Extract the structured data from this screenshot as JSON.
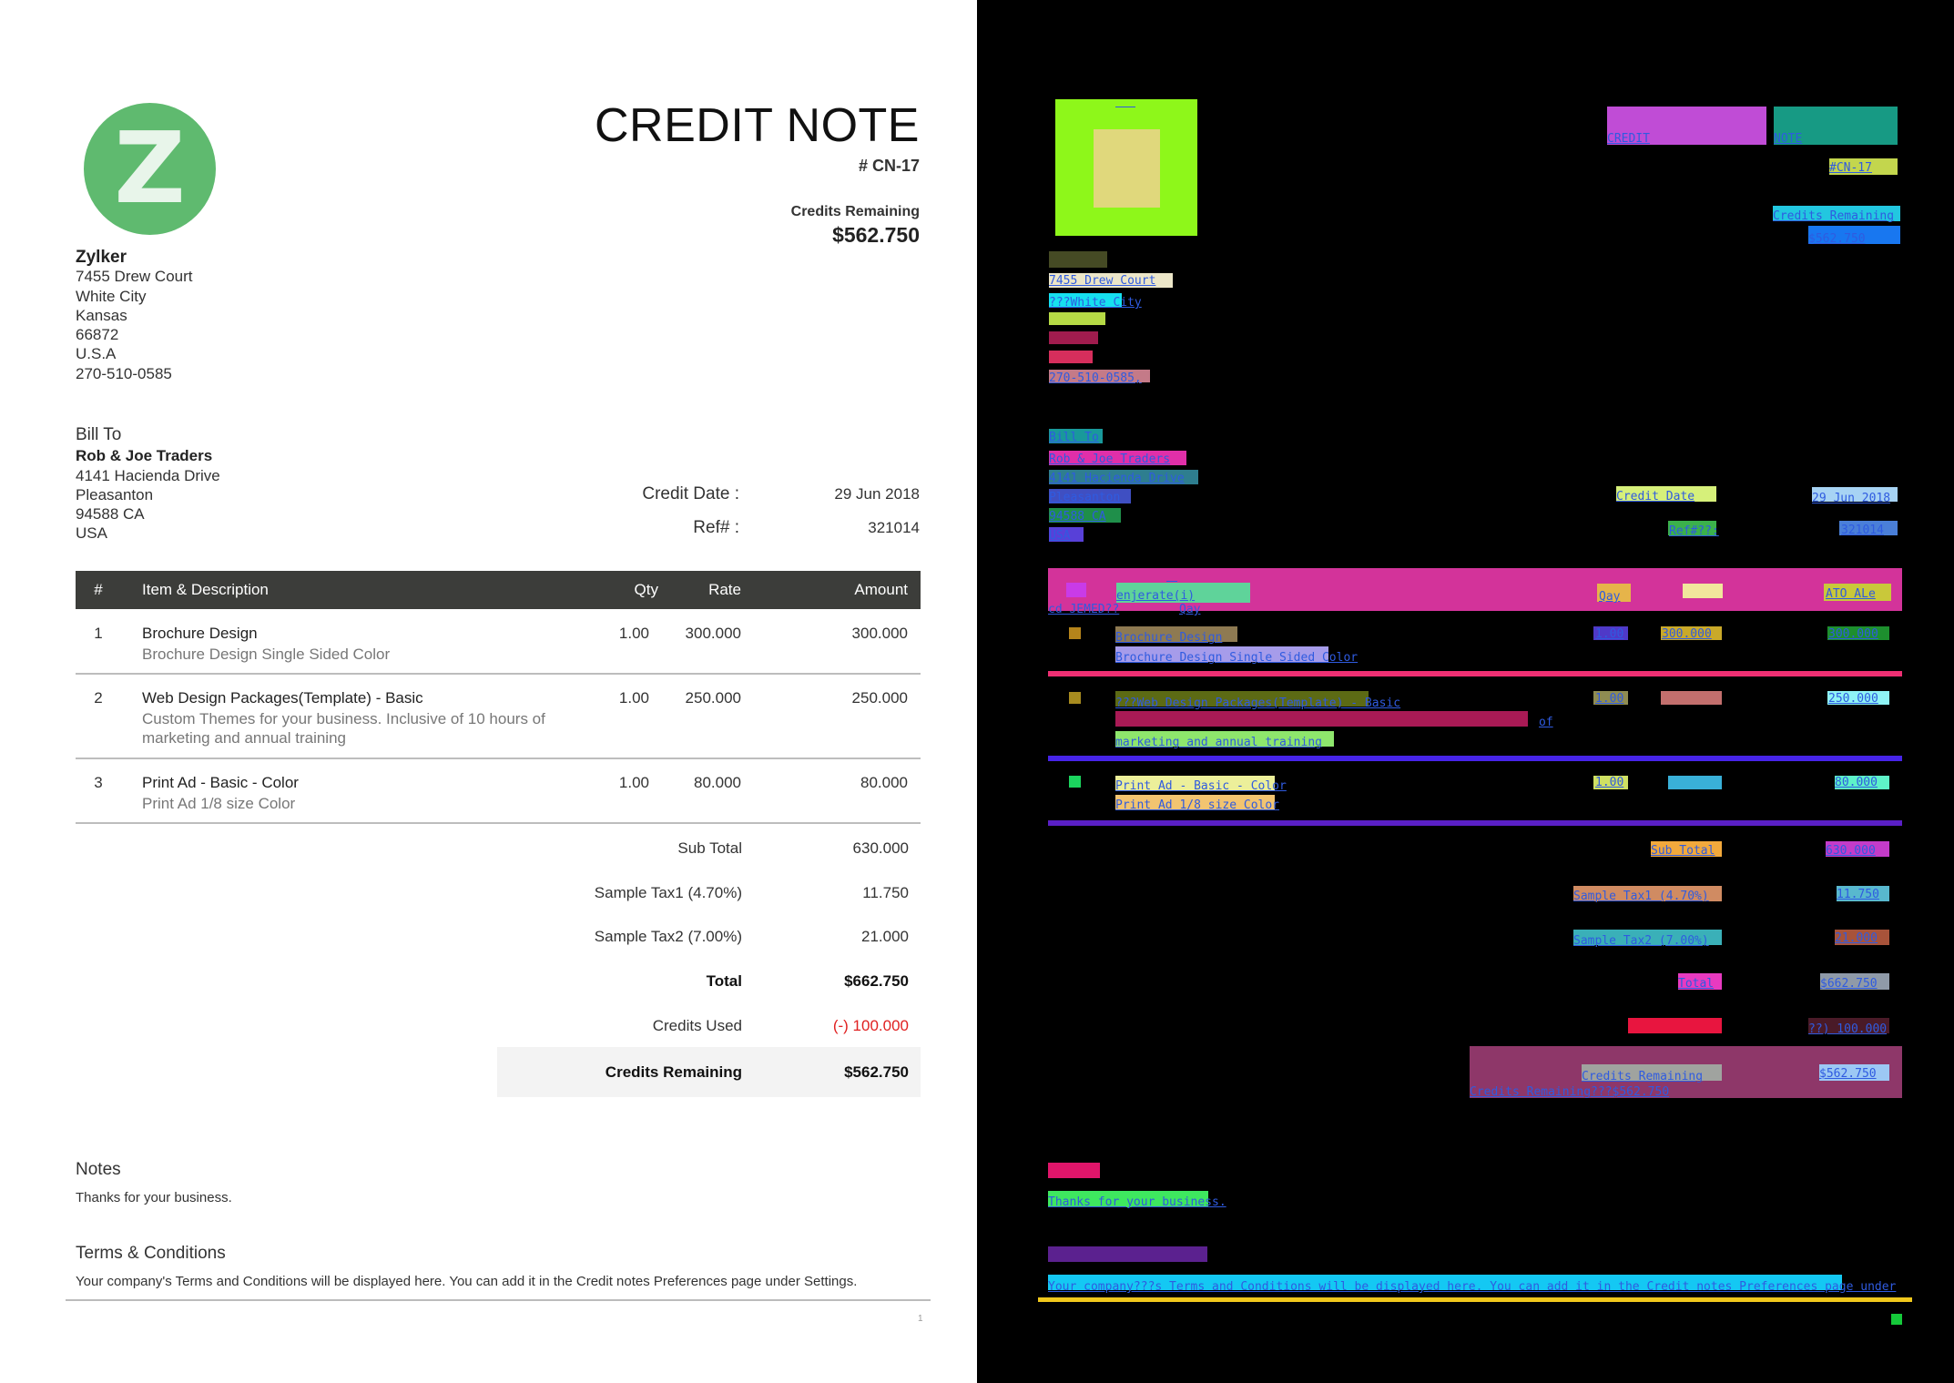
{
  "document": {
    "logo_letter": "Z",
    "title": "CREDIT NOTE",
    "number": "# CN-17",
    "credits_remaining_label": "Credits Remaining",
    "credits_remaining_amount": "$562.750"
  },
  "organization": {
    "name": "Zylker",
    "address_lines": [
      "7455 Drew Court",
      "White City",
      "Kansas",
      "66872",
      "U.S.A",
      "270-510-0585"
    ]
  },
  "bill_to": {
    "label": "Bill To",
    "name": "Rob & Joe Traders",
    "address_lines": [
      "4141 Hacienda Drive",
      "Pleasanton",
      "94588 CA",
      "USA"
    ]
  },
  "meta": {
    "credit_date_label": "Credit Date :",
    "credit_date_value": "29 Jun 2018",
    "ref_label": "Ref# :",
    "ref_value": "321014"
  },
  "table": {
    "headers": {
      "num": "#",
      "item": "Item & Description",
      "qty": "Qty",
      "rate": "Rate",
      "amount": "Amount"
    },
    "rows": [
      {
        "num": "1",
        "name": "Brochure Design",
        "description": "Brochure Design Single Sided Color",
        "qty": "1.00",
        "rate": "300.000",
        "amount": "300.000"
      },
      {
        "num": "2",
        "name": "Web Design Packages(Template) - Basic",
        "description_lines": [
          "Custom Themes for your business. Inclusive of 10 hours of",
          "marketing and annual training"
        ],
        "qty": "1.00",
        "rate": "250.000",
        "amount": "250.000"
      },
      {
        "num": "3",
        "name": "Print Ad - Basic - Color",
        "description": "Print Ad 1/8 size Color",
        "qty": "1.00",
        "rate": "80.000",
        "amount": "80.000"
      }
    ]
  },
  "totals": {
    "sub_total_label": "Sub Total",
    "sub_total": "630.000",
    "tax1_label": "Sample Tax1 (4.70%)",
    "tax1": "11.750",
    "tax2_label": "Sample Tax2 (7.00%)",
    "tax2": "21.000",
    "total_label": "Total",
    "total": "$662.750",
    "credits_used_label": "Credits Used",
    "credits_used": "(-) 100.000",
    "credits_remaining_label": "Credits Remaining",
    "credits_remaining": "$562.750"
  },
  "notes": {
    "heading": "Notes",
    "text": "Thanks for your business."
  },
  "terms": {
    "heading": "Terms & Conditions",
    "text": "Your company's Terms and Conditions will be displayed here. You can add it in the Credit notes Preferences page under Settings."
  },
  "page_number": "1",
  "overlay_labels": {
    "title_1": "CREDIT",
    "title_2": "NOTE",
    "number": "#CN-17",
    "credits_remaining": "Credits Remaining",
    "credits_amount": "$562.750",
    "org_line1": "7455 Drew Court",
    "org_line2": "???White City",
    "org_phone": "270-510-0585,",
    "bill_to": "Bill To",
    "bt_name": "Rob & Joe Traders",
    "bt_line1": "4141 Hacienda Drive",
    "bt_line2": "Pleasanton",
    "bt_line3": "94588 CA",
    "bt_line4": "USA",
    "credit_date": "Credit Date",
    "credit_date_value": "29 Jun 2018",
    "ref": "Ref#??:",
    "ref_value": "321014",
    "head_item": "enjerate(i)",
    "head_qty": "Qay",
    "head_amount": "ATO ALe",
    "head_under_1": "cd JEMED??",
    "head_under_2": "Qay",
    "r1_name": "Brochure Design",
    "r1_desc": "Brochure Design Single Sided Color",
    "r1_qty": "1.00",
    "r1_rate": "300.000",
    "r1_amount": "300.000",
    "r2_name": "???Web Design Packages(Template)   - Basic",
    "r2_desc_end": "of",
    "r2_desc2": "marketing and annual training",
    "r2_qty": "1.00",
    "r2_amount": "250.000",
    "r3_name": "Print Ad - Basic - Color",
    "r3_desc": "Print Ad 1/8 size Color",
    "r3_qty": "1.00",
    "r3_amount": "80.000",
    "sub_total": "Sub Total",
    "sub_total_value": "630.000",
    "tax1": "Sample Tax1 (4.70%)",
    "tax1_value": "11.750",
    "tax2": "Sample Tax2 (7.00%)",
    "tax2_value": "21.000",
    "total": "Total",
    "total_value": "$662.750",
    "credits_used_value": "??) 100.000",
    "cr_label": "Credits Remaining",
    "cr_value": "$562.750",
    "cr_overflow": "Credits Remaining???$562.750",
    "notes_text": "Thanks for your business.",
    "terms_text": "Your company???s Terms and Conditions will be displayed here. You can add it in the Credit notes Preferences page under"
  }
}
